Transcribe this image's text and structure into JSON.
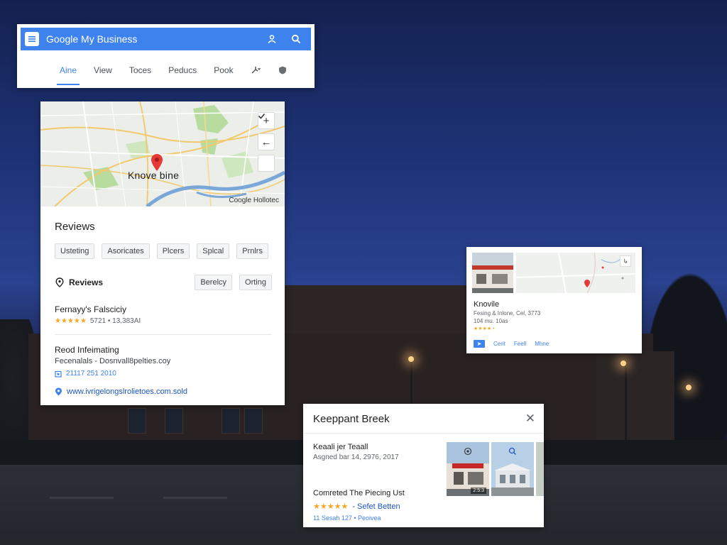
{
  "header": {
    "title": "Google My Business",
    "tabs": [
      "Aine",
      "View",
      "Toces",
      "Peducs",
      "Pook"
    ],
    "active_tab": 0
  },
  "listing": {
    "map": {
      "label": "Knove bine",
      "credit": "Coogle Hollotec"
    },
    "section_title": "Reviews",
    "chips": [
      "Usteting",
      "Asoricates",
      "Plcers",
      "Splcal",
      "Prnlrs"
    ],
    "reviews_title": "Reviews",
    "reviews_chips": [
      "Berelcy",
      "Orting"
    ],
    "entry": {
      "name": "Fernayy's Falsciciy",
      "stars": "★★★★★",
      "meta": "5721 • 13,383AI"
    },
    "info": {
      "title": "Reod Infeimating",
      "text": "Fecenalals - Dosnvall8pelties.coy",
      "date": "21117 251 2010",
      "link": "www.ivrigelongslrolietoes.com.sold"
    }
  },
  "mini_card": {
    "name": "Knovile",
    "address": "Fesing & Inlone, Cel, 3773",
    "hours": "104 mu. 10as",
    "stars": "★★★★ •",
    "actions": [
      "Cerit",
      "Feell",
      "Mhne"
    ]
  },
  "bottom_card": {
    "title": "Keeppant Breek",
    "close_symbol": "✕",
    "subtitle": "Keaali jer Teaall",
    "date": "Asgned bar 14, 2976, 2017",
    "pick_label": "Comreted The Piecing Ust",
    "stars": "★★★★★",
    "rating_link": "- Sefet Betten",
    "count": "11 Sesah 127 • Peoivea",
    "photo_badge": "2:5:3"
  },
  "colors": {
    "brand_blue": "#3e82ee",
    "star": "#f5a623",
    "map_pin": "#e53935"
  },
  "icons": {
    "header": [
      "menu-icon",
      "person-icon",
      "search-icon",
      "share-icon",
      "shield-icon"
    ],
    "map": [
      "zoom-in-icon",
      "back-arrow-icon",
      "check-icon",
      "map-pin-icon"
    ],
    "listing": [
      "location-pin-icon",
      "calendar-icon",
      "globe-icon"
    ]
  }
}
